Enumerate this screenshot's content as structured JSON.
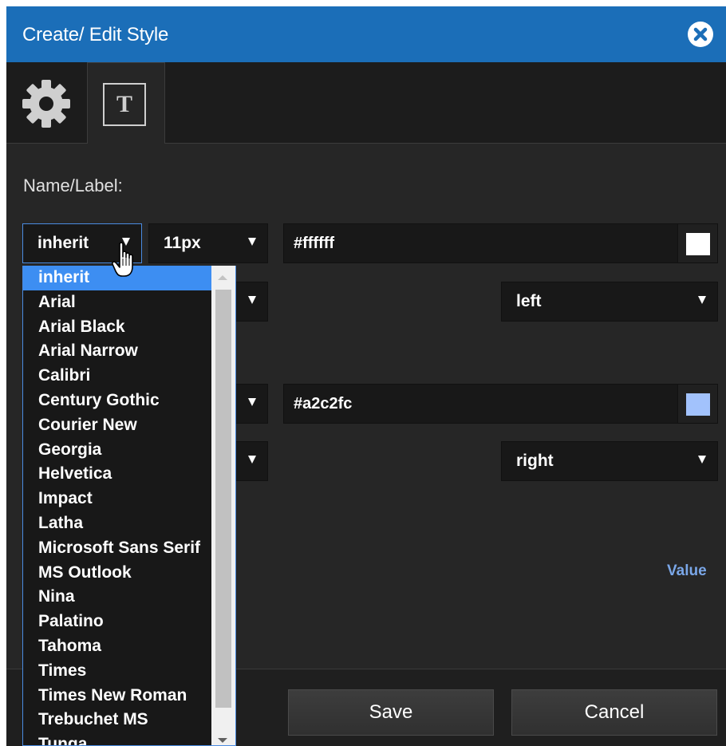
{
  "dialog": {
    "title": "Create/ Edit Style",
    "close_icon": "close-circle-icon"
  },
  "tabs": [
    {
      "icon": "gear-icon",
      "active": false
    },
    {
      "icon": "text-t-icon",
      "label": "T",
      "active": true
    }
  ],
  "form": {
    "name_label": "Name/Label:",
    "row1": {
      "font_family": "inherit",
      "font_size": "11px",
      "color": "#ffffff",
      "swatch_color": "#ffffff"
    },
    "row2": {
      "align": "left"
    },
    "row3": {
      "color": "#a2c2fc",
      "swatch_color": "#a2c2fc"
    },
    "row4": {
      "align": "right"
    },
    "value_link": "Value"
  },
  "font_dropdown": {
    "selected": "inherit",
    "options": [
      "inherit",
      "Arial",
      "Arial Black",
      "Arial Narrow",
      "Calibri",
      "Century Gothic",
      "Courier New",
      "Georgia",
      "Helvetica",
      "Impact",
      "Latha",
      "Microsoft Sans Serif",
      "MS Outlook",
      "Nina",
      "Palatino",
      "Tahoma",
      "Times",
      "Times New Roman",
      "Trebuchet MS",
      "Tunga"
    ]
  },
  "footer": {
    "save_label": "Save",
    "cancel_label": "Cancel"
  },
  "colors": {
    "titlebar": "#1b6eb8",
    "accent": "#3d8ef2",
    "link": "#7aa7e8"
  }
}
